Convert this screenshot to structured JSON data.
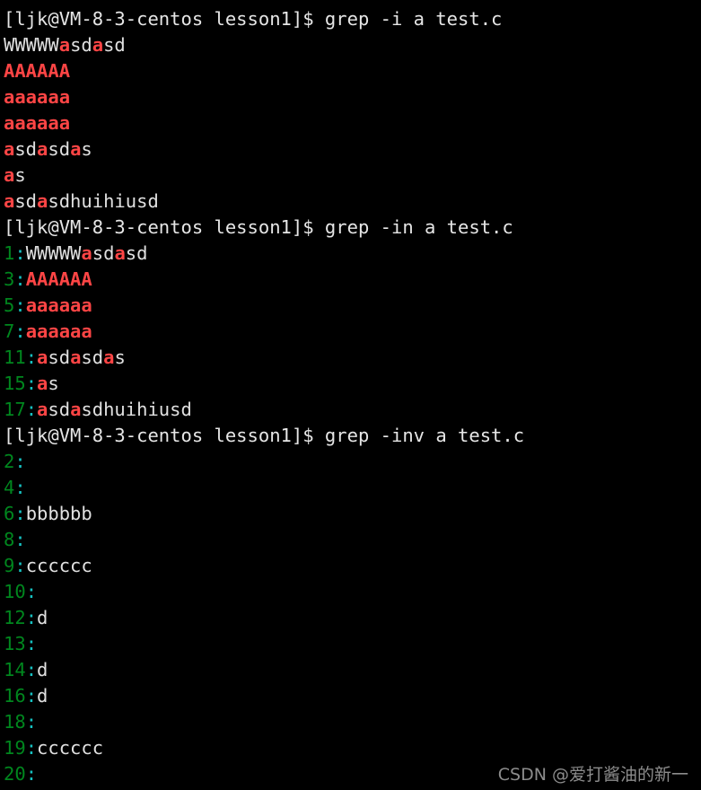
{
  "terminal": {
    "background_color": "#000000",
    "foreground_color": "#e0e0e0",
    "match_color": "#ff4545",
    "lineno_color": "#00861e",
    "separator_color": "#16c1c1",
    "prompt": "[ljk@VM-8-3-centos lesson1]$ ",
    "blocks": [
      {
        "command": "grep -i a test.c",
        "results": [
          {
            "lineno": null,
            "segments": [
              {
                "text": "WWWWW",
                "kind": "plain"
              },
              {
                "text": "a",
                "kind": "match"
              },
              {
                "text": "sd",
                "kind": "plain"
              },
              {
                "text": "a",
                "kind": "match"
              },
              {
                "text": "sd",
                "kind": "plain"
              }
            ]
          },
          {
            "lineno": null,
            "segments": [
              {
                "text": "AAAAAA",
                "kind": "match"
              }
            ]
          },
          {
            "lineno": null,
            "segments": [
              {
                "text": "aaaaaa",
                "kind": "match"
              }
            ]
          },
          {
            "lineno": null,
            "segments": [
              {
                "text": "aaaaaa",
                "kind": "match"
              }
            ]
          },
          {
            "lineno": null,
            "segments": [
              {
                "text": "a",
                "kind": "match"
              },
              {
                "text": "sd",
                "kind": "plain"
              },
              {
                "text": "a",
                "kind": "match"
              },
              {
                "text": "sd",
                "kind": "plain"
              },
              {
                "text": "a",
                "kind": "match"
              },
              {
                "text": "s",
                "kind": "plain"
              }
            ]
          },
          {
            "lineno": null,
            "segments": [
              {
                "text": "a",
                "kind": "match"
              },
              {
                "text": "s",
                "kind": "plain"
              }
            ]
          },
          {
            "lineno": null,
            "segments": [
              {
                "text": "a",
                "kind": "match"
              },
              {
                "text": "sd",
                "kind": "plain"
              },
              {
                "text": "a",
                "kind": "match"
              },
              {
                "text": "sdhuihiusd",
                "kind": "plain"
              }
            ]
          }
        ]
      },
      {
        "command": "grep -in a test.c",
        "results": [
          {
            "lineno": "1",
            "segments": [
              {
                "text": "WWWWW",
                "kind": "plain"
              },
              {
                "text": "a",
                "kind": "match"
              },
              {
                "text": "sd",
                "kind": "plain"
              },
              {
                "text": "a",
                "kind": "match"
              },
              {
                "text": "sd",
                "kind": "plain"
              }
            ]
          },
          {
            "lineno": "3",
            "segments": [
              {
                "text": "AAAAAA",
                "kind": "match"
              }
            ]
          },
          {
            "lineno": "5",
            "segments": [
              {
                "text": "aaaaaa",
                "kind": "match"
              }
            ]
          },
          {
            "lineno": "7",
            "segments": [
              {
                "text": "aaaaaa",
                "kind": "match"
              }
            ]
          },
          {
            "lineno": "11",
            "segments": [
              {
                "text": "a",
                "kind": "match"
              },
              {
                "text": "sd",
                "kind": "plain"
              },
              {
                "text": "a",
                "kind": "match"
              },
              {
                "text": "sd",
                "kind": "plain"
              },
              {
                "text": "a",
                "kind": "match"
              },
              {
                "text": "s",
                "kind": "plain"
              }
            ]
          },
          {
            "lineno": "15",
            "segments": [
              {
                "text": "a",
                "kind": "match"
              },
              {
                "text": "s",
                "kind": "plain"
              }
            ]
          },
          {
            "lineno": "17",
            "segments": [
              {
                "text": "a",
                "kind": "match"
              },
              {
                "text": "sd",
                "kind": "plain"
              },
              {
                "text": "a",
                "kind": "match"
              },
              {
                "text": "sdhuihiusd",
                "kind": "plain"
              }
            ]
          }
        ]
      },
      {
        "command": "grep -inv a test.c",
        "results": [
          {
            "lineno": "2",
            "segments": []
          },
          {
            "lineno": "4",
            "segments": []
          },
          {
            "lineno": "6",
            "segments": [
              {
                "text": "bbbbbb",
                "kind": "plain"
              }
            ]
          },
          {
            "lineno": "8",
            "segments": []
          },
          {
            "lineno": "9",
            "segments": [
              {
                "text": "cccccc",
                "kind": "plain"
              }
            ]
          },
          {
            "lineno": "10",
            "segments": []
          },
          {
            "lineno": "12",
            "segments": [
              {
                "text": "d",
                "kind": "plain"
              }
            ]
          },
          {
            "lineno": "13",
            "segments": []
          },
          {
            "lineno": "14",
            "segments": [
              {
                "text": "d",
                "kind": "plain"
              }
            ]
          },
          {
            "lineno": "16",
            "segments": [
              {
                "text": "d",
                "kind": "plain"
              }
            ]
          },
          {
            "lineno": "18",
            "segments": []
          },
          {
            "lineno": "19",
            "segments": [
              {
                "text": "cccccc",
                "kind": "plain"
              }
            ]
          },
          {
            "lineno": "20",
            "segments": []
          }
        ]
      }
    ]
  },
  "watermark": {
    "text": "CSDN @爱打酱油的新一"
  }
}
